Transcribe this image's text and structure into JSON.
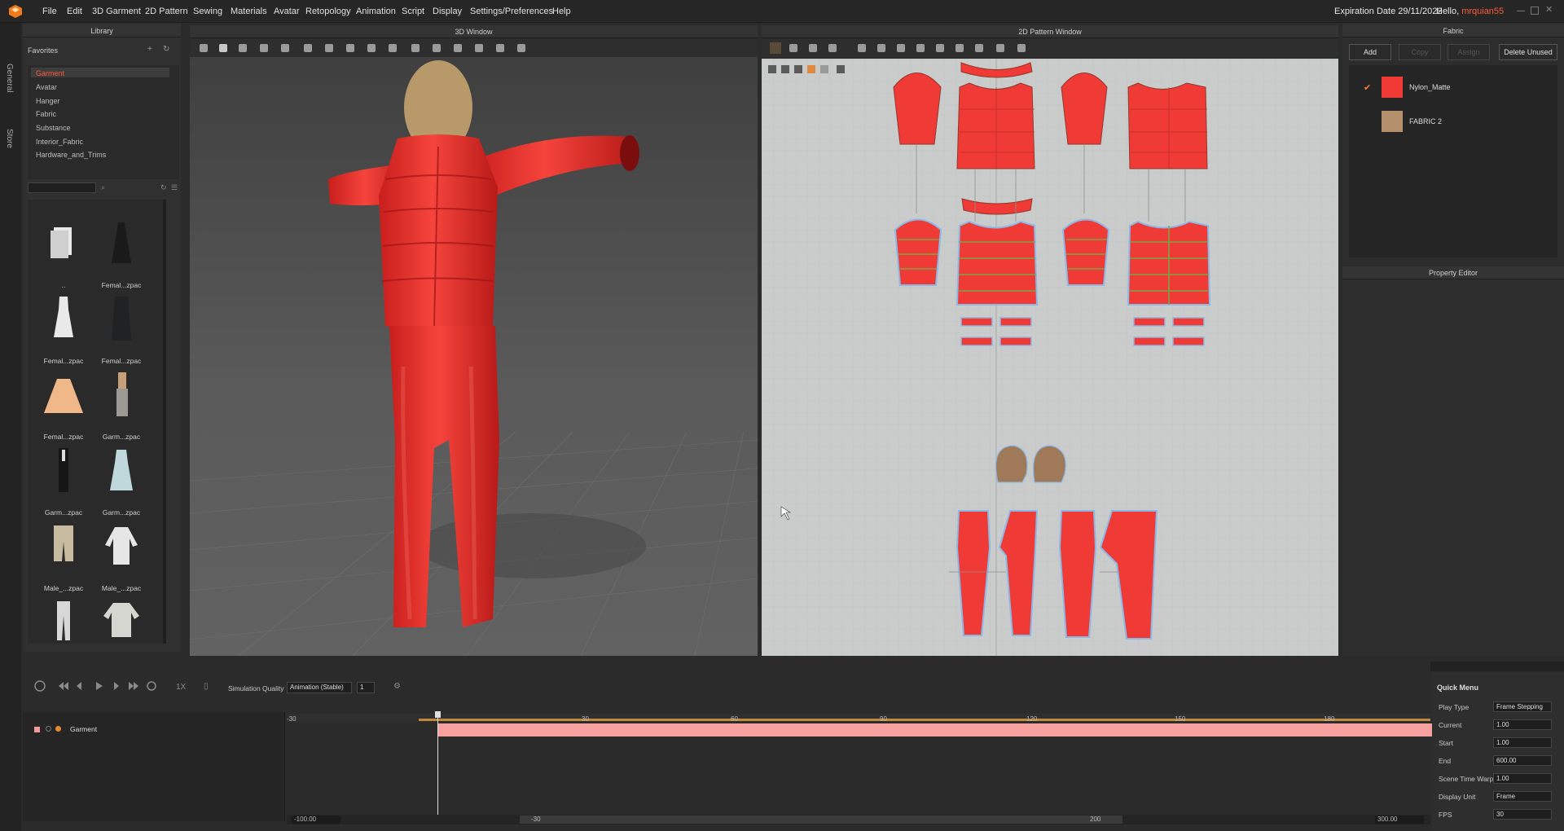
{
  "menubar": {
    "items": [
      "File",
      "Edit",
      "3D Garment",
      "2D Pattern",
      "Sewing",
      "Materials",
      "Avatar",
      "Retopology",
      "Animation",
      "Script",
      "Display",
      "Settings/Preferences",
      "Help"
    ],
    "expiration": "Expiration Date 29/11/2022",
    "hello_prefix": "Hello, ",
    "username": "mrquian55"
  },
  "side_tabs": [
    "General",
    "Store"
  ],
  "library": {
    "title": "Library",
    "favorites": "Favorites",
    "tree": [
      "Garment",
      "Avatar",
      "Hanger",
      "Fabric",
      "Substance",
      "Interior_Fabric",
      "Hardware_and_Trims"
    ],
    "selected": "Garment",
    "thumbs": [
      "..",
      "Femal...zpac",
      "Femal...zpac",
      "Femal...zpac",
      "Femal...zpac",
      "Garm...zpac",
      "Garm...zpac",
      "Garm...zpac",
      "Male_...zpac",
      "Male_...zpac",
      "",
      ""
    ]
  },
  "window3d": {
    "title": "3D Window"
  },
  "window2d": {
    "title": "2D Pattern Window"
  },
  "fabric": {
    "title": "Fabric",
    "buttons": [
      "Add",
      "Copy",
      "Assign",
      "Delete Unused"
    ],
    "items": [
      {
        "name": "Nylon_Matte",
        "color": "#f03a35",
        "checked": true
      },
      {
        "name": "FABRIC 2",
        "color": "#b4916c",
        "checked": false
      }
    ]
  },
  "property_editor": {
    "title": "Property Editor"
  },
  "timeline": {
    "simulation_quality_label": "Simulation Quality",
    "simulation_quality_value": "Animation (Stable)",
    "step_value": "1",
    "speed": "1X",
    "track_name": "Garment",
    "ticks": [
      "-30",
      "30",
      "60",
      "90",
      "120",
      "150",
      "180"
    ],
    "range_left": "-100.00",
    "scroll_left": "-30",
    "scroll_right": "200",
    "range_right": "300.00"
  },
  "quick_menu": {
    "title": "Quick Menu",
    "rows": [
      {
        "label": "Play Type",
        "value": "Frame Stepping"
      },
      {
        "label": "Current",
        "value": "1.00"
      },
      {
        "label": "Start",
        "value": "1.00"
      },
      {
        "label": "End",
        "value": "600.00"
      },
      {
        "label": "Scene Time Warp",
        "value": "1.00"
      },
      {
        "label": "Display Unit",
        "value": "Frame"
      },
      {
        "label": "FPS",
        "value": "30"
      }
    ]
  },
  "colors": {
    "accent": "#ff5a36",
    "garment": "#f03a35",
    "seam": "#8cb8e8",
    "skin": "#b48a5c"
  }
}
